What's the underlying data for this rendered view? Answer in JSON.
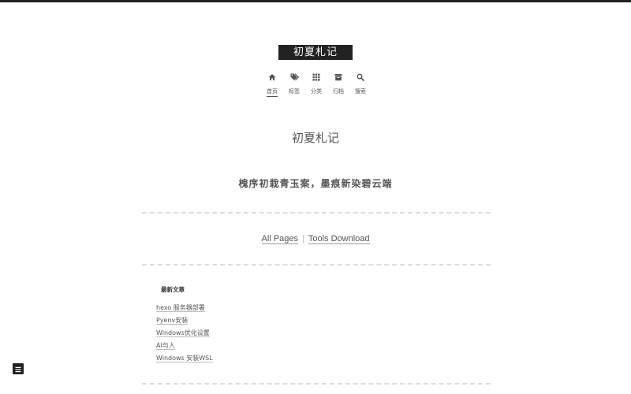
{
  "header": {
    "brand": "初夏札记"
  },
  "menu": [
    {
      "label": "首页",
      "icon": "home-icon",
      "active": true
    },
    {
      "label": "标签",
      "icon": "tags-icon",
      "active": false
    },
    {
      "label": "分类",
      "icon": "grid-icon",
      "active": false
    },
    {
      "label": "归档",
      "icon": "archive-icon",
      "active": false
    },
    {
      "label": "搜索",
      "icon": "search-icon",
      "active": false
    }
  ],
  "main": {
    "title": "初夏札记",
    "motto": "槐序初栽青玉案，墨痕新染碧云端"
  },
  "links": {
    "all_pages": "All Pages",
    "separator": "|",
    "tools_download": "Tools Download"
  },
  "recent": {
    "title": "最新文章",
    "items": [
      "hexo 服务器部署",
      "Pyenv安装",
      "Windows优化设置",
      "AI与人",
      "Windows 安装WSL"
    ]
  },
  "colors": {
    "brand_bg": "#222222",
    "text": "#555555",
    "divider": "#dddddd"
  }
}
